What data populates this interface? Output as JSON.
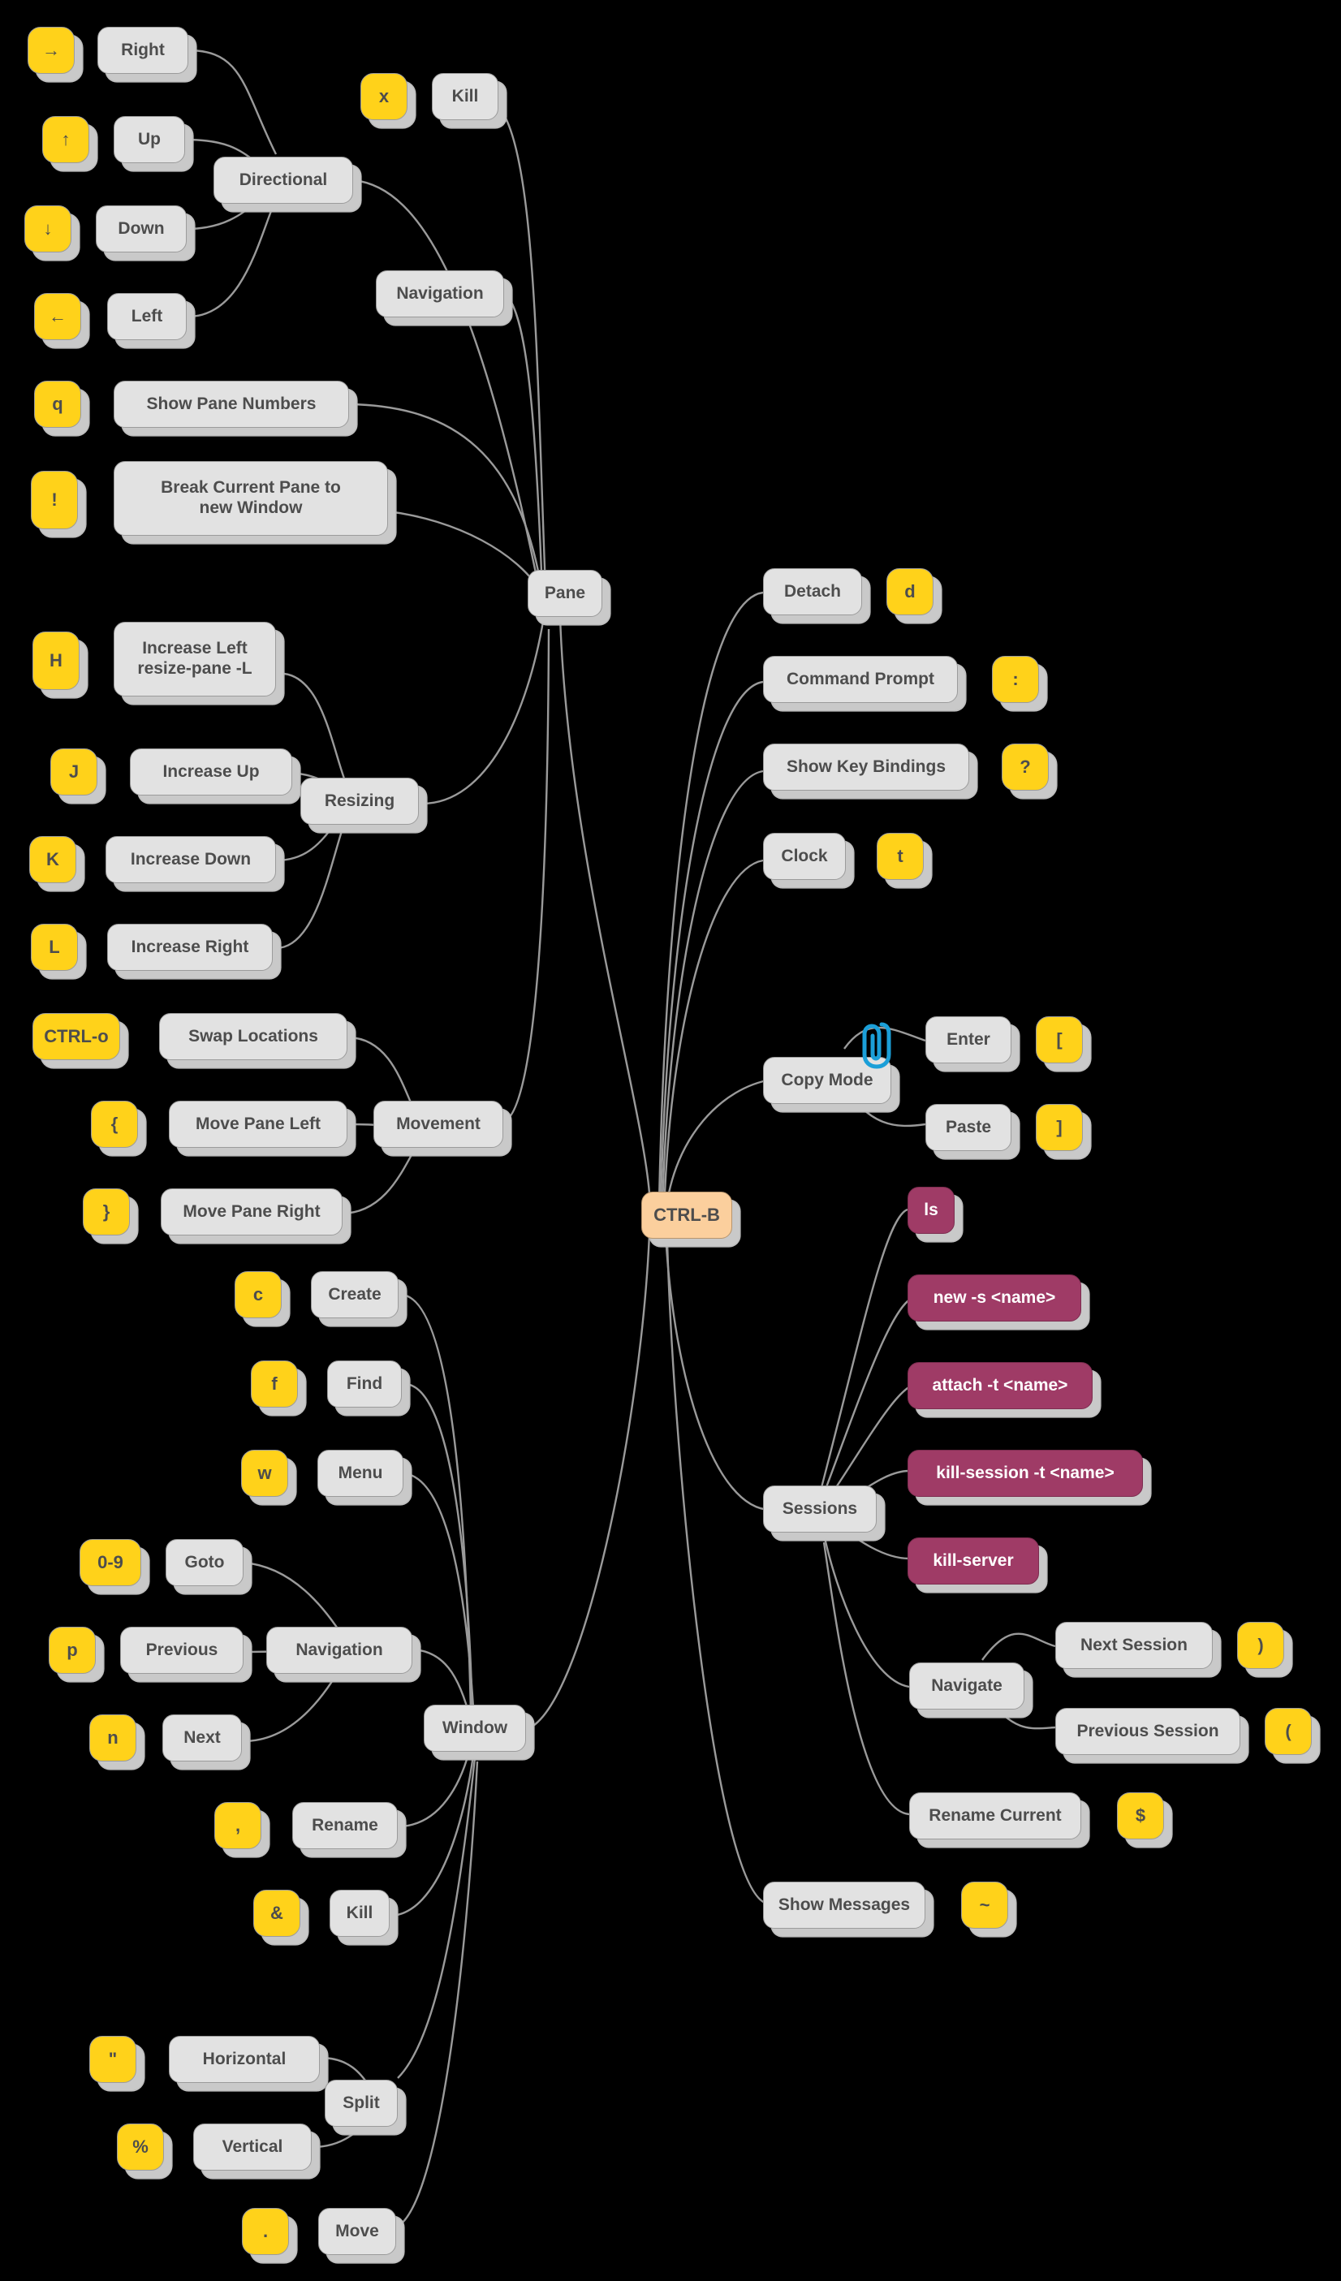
{
  "diagram": {
    "title": "tmux CTRL-B cheat sheet mind map",
    "background": "#000000",
    "colors": {
      "key": "#ffd21a",
      "topic": "#e2e2e2",
      "root": "#fbcf9d",
      "command": "#9f3b66",
      "edge": "#9a9a9a",
      "text": "#4d4d4d",
      "command_text": "#ffffff",
      "clip_icon": "#1b9fd8"
    },
    "root": {
      "label": "CTRL-B"
    }
  },
  "nodes": {
    "right_key": "→",
    "right": "Right",
    "up_key": "↑",
    "up": "Up",
    "down_key": "↓",
    "down": "Down",
    "left_key": "←",
    "left": "Left",
    "directional": "Directional",
    "x_key": "x",
    "kill_pane": "Kill",
    "pane_navigation": "Navigation",
    "q_key": "q",
    "show_pane_numbers": "Show Pane Numbers",
    "bang_key": "!",
    "break_pane": "Break Current Pane to\nnew Window",
    "pane": "Pane",
    "H_key": "H",
    "increase_left": "Increase Left\nresize-pane -L",
    "J_key": "J",
    "increase_up": "Increase Up",
    "K_key": "K",
    "increase_down": "Increase Down",
    "L_key": "L",
    "increase_right": "Increase Right",
    "resizing": "Resizing",
    "ctrlo_key": "CTRL-o",
    "swap_locations": "Swap Locations",
    "brace_open_key": "{",
    "move_pane_left": "Move Pane Left",
    "brace_close_key": "}",
    "move_pane_right": "Move Pane Right",
    "movement": "Movement",
    "detach": "Detach",
    "detach_key": "d",
    "command_prompt": "Command Prompt",
    "command_prompt_key": ":",
    "show_key_bindings": "Show Key Bindings",
    "show_key_bindings_key": "?",
    "clock": "Clock",
    "clock_key": "t",
    "copy_mode": "Copy Mode",
    "enter": "Enter",
    "enter_key": "[",
    "paste": "Paste",
    "paste_key": "]",
    "sessions": "Sessions",
    "sessions_ls": "ls",
    "sessions_new": "new -s <name>",
    "sessions_attach": "attach -t <name>",
    "sessions_kill_session": "kill-session -t <name>",
    "sessions_kill_server": "kill-server",
    "session_navigate": "Navigate",
    "next_session": "Next Session",
    "next_session_key": ")",
    "previous_session": "Previous Session",
    "previous_session_key": "(",
    "rename_current": "Rename Current",
    "rename_current_key": "$",
    "show_messages": "Show Messages",
    "show_messages_key": "~",
    "c_key": "c",
    "window_create": "Create",
    "f_key": "f",
    "window_find": "Find",
    "w_key": "w",
    "window_menu": "Menu",
    "digits_key": "0-9",
    "window_goto": "Goto",
    "p_key": "p",
    "window_previous": "Previous",
    "n_key": "n",
    "window_next": "Next",
    "window_navigation": "Navigation",
    "comma_key": ",",
    "window_rename": "Rename",
    "amp_key": "&",
    "window_kill": "Kill",
    "window": "Window",
    "quote_key": "\"",
    "split_horizontal": "Horizontal",
    "percent_key": "%",
    "split_vertical": "Vertical",
    "split": "Split",
    "dot_key": ".",
    "window_move": "Move"
  },
  "icons": {
    "copy_mode_clip": "paperclip-icon"
  }
}
